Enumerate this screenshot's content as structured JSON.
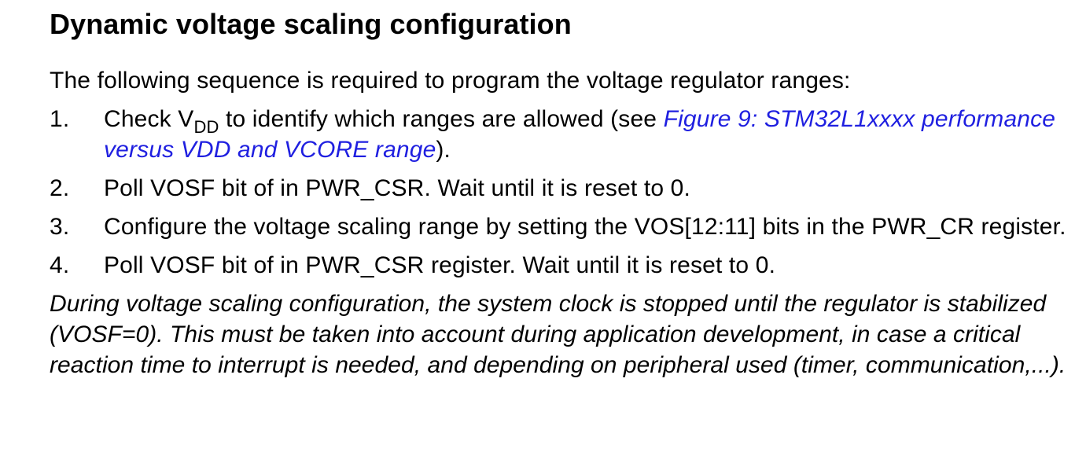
{
  "section": {
    "title": "Dynamic voltage scaling configuration",
    "intro": "The following sequence is required to program the voltage regulator ranges:"
  },
  "steps": [
    {
      "number": "1.",
      "text_before": "Check V",
      "subscript": "DD",
      "text_after": " to identify which ranges are allowed (see ",
      "link_text": "Figure 9: STM32L1xxxx performance versus VDD and VCORE range",
      "text_end": ")."
    },
    {
      "number": "2.",
      "text": "Poll VOSF bit of in PWR_CSR. Wait until it is reset to 0."
    },
    {
      "number": "3.",
      "text": "Configure the voltage scaling range by setting the VOS[12:11] bits in the PWR_CR register."
    },
    {
      "number": "4.",
      "text": "Poll VOSF bit of in PWR_CSR register. Wait until it is reset to 0."
    }
  ],
  "note": "During voltage scaling configuration, the system clock is stopped until the regulator is stabilized (VOSF=0). This must be taken into account during application development, in case a critical reaction time to interrupt is needed, and depending on peripheral used (timer, communication,...).",
  "colors": {
    "link": "#1f1fe0",
    "text": "#000000",
    "background": "#ffffff"
  }
}
